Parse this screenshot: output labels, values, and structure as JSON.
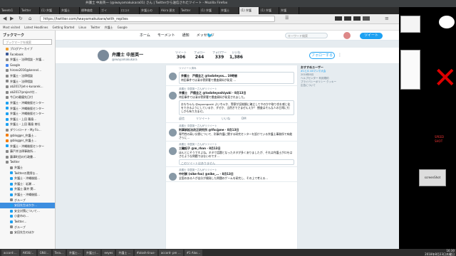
{
  "window": {
    "title": "弁護士 中居英一 (@iwayamakukara01) さん | Twitterから送信されたツイート - Mozilla Firefox"
  },
  "tabs": [
    "Tweets1",
    "Twitter",
    "(1) 弁護",
    "弁護士",
    "標準偏差",
    "ガイ",
    "口コミ",
    "弁護士の",
    "Akira 匿名",
    "Twitter",
    "(1) 弁護",
    "弁護士",
    "(1) 弁護",
    "(1) 弁護",
    "弁護"
  ],
  "url": "https://twitter.com/iwayamakukara/with_replies",
  "bookmarks": [
    "Most visited",
    "Latest Headlines",
    "Getting Started",
    "Linux",
    "Twitter",
    "弁護士",
    "Google"
  ],
  "sidebar": {
    "title": "ブックマーク",
    "search_placeholder": "ブックマークを検索",
    "items": [
      {
        "label": "ブログアーカイブ",
        "color": "#f0a030"
      },
      {
        "label": "Facebook",
        "color": "#3b5998"
      },
      {
        "label": "弁護士・法律相談・弁護…",
        "color": "#888"
      },
      {
        "label": "Google",
        "color": "#4285f4"
      },
      {
        "label": "hirono2016@kennel…",
        "color": "#888"
      },
      {
        "label": "弁護士・法律相談",
        "color": "#888"
      },
      {
        "label": "弁護士・法律相談",
        "color": "#888"
      },
      {
        "label": "ab2017/jet-s-kunarek…",
        "color": "#888"
      },
      {
        "label": "ab2017/project付…",
        "color": "#888"
      },
      {
        "label": "今日の最優先日付",
        "color": "#888"
      },
      {
        "label": "弁護士・沖縄後援センター",
        "color": "#1da1f2"
      },
      {
        "label": "弁護士・沖縄後援センター",
        "color": "#1da1f2"
      },
      {
        "label": "弁護士・沖縄後援センター",
        "color": "#1da1f2"
      },
      {
        "label": "弁護士・上田 羅島…",
        "color": "#1da1f2"
      },
      {
        "label": "弁護士・上田 羅島 商社",
        "color": "#1da1f2"
      },
      {
        "label": "ダウンロード・My Fo…",
        "color": "#888"
      },
      {
        "label": "@blogger_弁護士…",
        "color": "#f57c00"
      },
      {
        "label": "@blogger_弁護士…",
        "color": "#f57c00"
      },
      {
        "label": "弁護士・沖縄後援センター",
        "color": "#1da1f2"
      },
      {
        "label": "藤戸井法律事務所…",
        "color": "#888"
      },
      {
        "label": "藤澤町田の行政書…",
        "color": "#888"
      },
      {
        "label": "Twitter",
        "color": "#888"
      },
      {
        "label": "弁護士",
        "color": "#888"
      },
      {
        "label": "Twitterの実際な…",
        "color": "#1da1f2"
      },
      {
        "label": "弁護士・沖縄後援…",
        "color": "#1da1f2"
      },
      {
        "label": "弁護士：岩瀬 …",
        "color": "#1da1f2"
      },
      {
        "label": "弁護士 藤井 関…",
        "color": "#1da1f2"
      },
      {
        "label": "弁護士・沖縄後援…",
        "color": "#1da1f2"
      },
      {
        "label": "グループ",
        "color": "#888"
      },
      {
        "label": "安田先生ほかか…",
        "color": "#1da1f2",
        "selected": true
      },
      {
        "label": "安全対策について…",
        "color": "#1da1f2"
      },
      {
        "label": "小倉市の…",
        "color": "#1da1f2"
      },
      {
        "label": "Twitter…",
        "color": "#1da1f2"
      },
      {
        "label": "グループ",
        "color": "#888"
      },
      {
        "label": "安田先生のほか",
        "color": "#888"
      }
    ]
  },
  "twitter_nav": {
    "home": "ホーム",
    "moments": "モーメント",
    "notifications": "通知",
    "messages": "メッセージ",
    "search_placeholder": "キーワード検索",
    "tweet_button": "ツイート"
  },
  "profile": {
    "name": "弁護士 中居英一",
    "handle": "@iwayamakukara",
    "stats": [
      {
        "label": "ツイート",
        "value": "306"
      },
      {
        "label": "フォロー",
        "value": "244"
      },
      {
        "label": "フォロワー",
        "value": "339"
      },
      {
        "label": "いいね",
        "value": "1,386"
      }
    ],
    "follow_button": "フォローする"
  },
  "timeline": [
    {
      "ctx": "リツイート済み",
      "author": "弁護士　戸舘圭之 @todateyos… 19時間",
      "body": "袴田事件では清水警察署で捜査資料が発見 …",
      "quote": ""
    },
    {
      "ctx": "弁護士 中居英一さんがリツイート",
      "author": "弁護士　戸舘圭之 @todateyoshiyuki · 8月13日",
      "body": "袴田事件では清水警察署で捜査資料が発見されました。",
      "quote": "おもちゃん @oguongoshi よいちゃか、警察が証拠類に確立してやのかや取り合を感じ化をできるようにしているか、ずせか、当然ぎでさまぜんえか？ 捜査はそんな人の日常に行しかも有り方ませ。"
    },
    {
      "ctx": "弁護士 中居英一さんがリツイート",
      "author": "刑事訴訟法改正研究所 @tfscjpne · 8月13日",
      "body": "専門性の高い分野について、刑事弁護に関する研究センターを設けている弁護士事務所で有能さらに…",
      "quote": ""
    },
    {
      "ctx": "弁護士 中居英一さんがリツイート",
      "author": "三輪記子 @m_rhan · 8月13日",
      "body": "ほんとにそうですよね。ネタで話題となったネタが多くありましたが、それは弁護士が口をはさむような問題ではないのです…",
      "quote": ""
    },
    {
      "ctx": "弁護士 中居英一さんがリツイート",
      "author": "中村崇 (nike-fox) @nike_… · 8月13日",
      "body": "全国のある人が自分が開発した問題のゲームを研究し、その上で考える…",
      "quote": ""
    }
  ],
  "more_tweets": "このツイートはありません",
  "tweet_actions": [
    "返信",
    "リツイート",
    "いいね",
    "DM"
  ],
  "right_column": {
    "heading": "おすすめユーザー",
    "lines": [
      "#1とJC ASマンホ大会",
      "2018年8月",
      "ヘルプセンター 利用規約",
      "プライバシーポリシー クッキー",
      "広告について"
    ]
  },
  "taskbar": {
    "items": [
      "accord:…",
      "AKS6/…",
      "GNU…",
      "Tera…",
      "弁護士…",
      "弁護士(…",
      "eeyes",
      "弁護士 …",
      "#alosh-linus-",
      "accord- pm …",
      "#1 Alos…"
    ],
    "time": "16:30",
    "date": "2018年8月23日木曜日"
  },
  "right_panel": {
    "panel_labels": [
      "screenShot",
      "SPEED",
      "SHOT"
    ]
  }
}
